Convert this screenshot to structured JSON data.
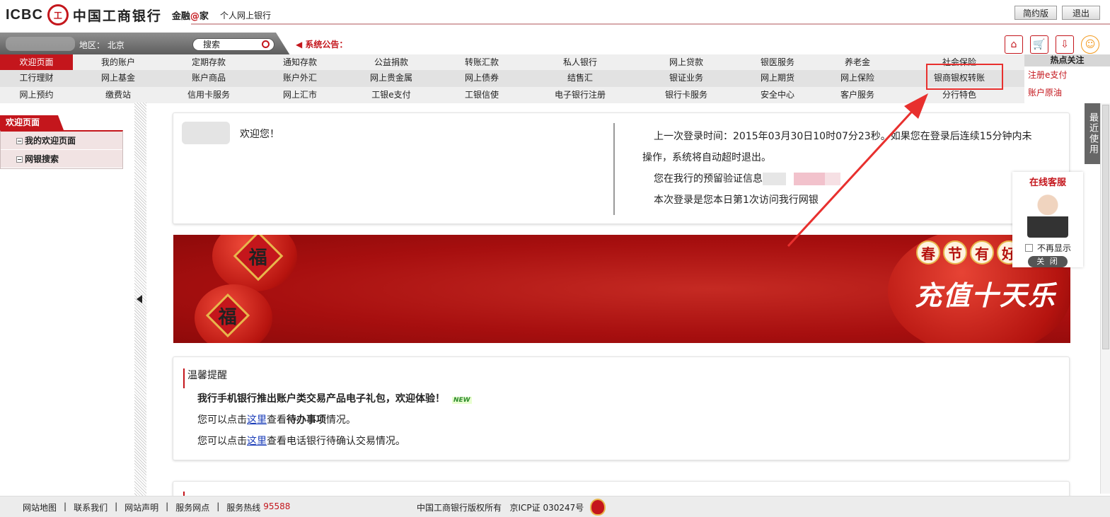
{
  "header": {
    "logo_text": "ICBC",
    "logo_mark": "工",
    "bank_name": "中国工商银行",
    "slogan_prefix": "金融",
    "slogan_at": "@",
    "slogan_suffix": "家",
    "subtitle": "个人网上银行",
    "btn_simple": "简约版",
    "btn_logout": "退出"
  },
  "location": {
    "label": "地区：  北京",
    "search_value": "搜索",
    "notice": "系统公告："
  },
  "nav": {
    "row1": [
      "欢迎页面",
      "我的账户",
      "定期存款",
      "通知存款",
      "公益捐款",
      "转账汇款",
      "私人银行",
      "网上贷款",
      "银医服务",
      "养老金",
      "社会保险"
    ],
    "row2": [
      "工行理财",
      "网上基金",
      "账户商品",
      "账户外汇",
      "网上贵金属",
      "网上债券",
      "结售汇",
      "银证业务",
      "网上期货",
      "网上保险",
      "银商银权转账"
    ],
    "row3": [
      "网上预约",
      "缴费站",
      "信用卡服务",
      "网上汇市",
      "工银e支付",
      "工银信使",
      "电子银行注册",
      "银行卡服务",
      "安全中心",
      "客户服务",
      "分行特色"
    ]
  },
  "hot": {
    "title": "热点关注",
    "items": [
      "注册e支付",
      "账户原油"
    ]
  },
  "sidebar": {
    "title": "欢迎页面",
    "items": [
      "我的欢迎页面",
      "网银搜索"
    ]
  },
  "welcome": {
    "greeting": "欢迎您！",
    "line1": "上一次登录时间：2015年03月30日10时07分23秒。如果您在登录后连续15分钟内未",
    "line2": "操作，系统将自动超时退出。",
    "line3": "您在我行的预留验证信息",
    "line4": "本次登录是您本日第1次访问我行网银"
  },
  "banner": {
    "fu": "福",
    "title_chars": [
      "春",
      "节",
      "有",
      "好"
    ],
    "subtitle": "充值十天乐"
  },
  "tips": {
    "title": "温馨提醒",
    "headline": "我行手机银行推出账户类交易产品电子礼包，欢迎体验！",
    "new_badge": "NEW",
    "l2_pre": "您可以点击",
    "l2_link": "这里",
    "l2_mid": "查看",
    "l2_bold": "待办事项",
    "l2_post": "情况。",
    "l3_pre": "您可以点击",
    "l3_link": "这里",
    "l3_post": "查看电话银行待确认交易情况。"
  },
  "right": {
    "recent": "最近使用",
    "cs_title": "在线客服",
    "cs_check": "不再显示",
    "cs_close": "关 闭"
  },
  "footer": {
    "links": [
      "网站地图",
      "联系我们",
      "网站声明",
      "服务网点",
      "服务热线"
    ],
    "hotline": "95588",
    "copyright": "中国工商银行版权所有",
    "icp": "京ICP证 030247号"
  },
  "colors": {
    "brand_red": "#c4161c",
    "annotation_red": "#e8302e"
  }
}
